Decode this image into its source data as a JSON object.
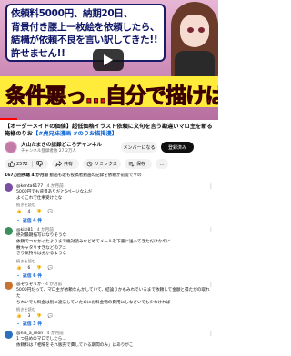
{
  "video": {
    "speech_text": "依頼料5000円、納期20日、\n背景付き腰上一枚絵を依頼したら、\n結構が依頼不良を言い訳してきた!!\n許せません!!",
    "banner_text": "条件悪っ…自分で描けば？",
    "progress": 0.08
  },
  "title": {
    "main": "【オーダーメイドの価値】超低価格イラスト依頼に文句を言う勘違いマロ主を斬る俺様のりお",
    "tags": "【#虎兄妹漫画 #のりお描掲漫】"
  },
  "channel": {
    "name": "大山たまきの記録どころチャンネル",
    "subs": "チャンネル登録者数 27.2万人",
    "member_label": "メンバーになる",
    "subscribe_label": "登録済み"
  },
  "actions": {
    "likes": "2572",
    "share": "共有",
    "remix": "リミックス",
    "save": "保存",
    "more": "…"
  },
  "description": {
    "views": "167万回視聴",
    "date": "4 か月前",
    "text": "動画も歌も投稿者動画の記録を依頼が前提ですの"
  },
  "comments": [
    {
      "user": "@kenta6177",
      "time": "4 か月前",
      "body": "5000円でも背景ありだと6ページなんだ\nよくこれで仕事受けたな",
      "more": "続きを読む",
      "likes": "4",
      "replies_label": "返信 4 件",
      "avatar_color": "#7a4ea3"
    },
    {
      "user": "@kikl81",
      "time": "4 か月前",
      "body": "絶対最期描写になりそうな\n依頼でつなかったよりまで絶対読みなどめてメールを下書に送ってきただけなのに\n敷キャタリすぎなどのアニ\nきり気持ちは分かるような",
      "more": "続きを読む",
      "likes": "6",
      "replies_label": "返信 6 件",
      "avatar_color": "#3a8f5c"
    },
    {
      "user": "@ぞうぞうか",
      "time": "4 か月前",
      "body": "5000円だって、マロ主が依頼なんかしていて、結論りかもみれでいるまで依頼して金額と得たがの取れた\nちれいでも料金は別に違法していたのにお料金物の費用にしなさいても少なければ",
      "more": "続きを読む",
      "likes": "3",
      "replies_label": "返信 3 件",
      "avatar_color": "#c9732e"
    },
    {
      "user": "@nia_a_mon",
      "time": "4 か月前",
      "body": "1 つ低めのマロでしたら…\n依頼料は「相場をそれ販売で費している期間のみ」はありがこ",
      "more": "",
      "likes": "",
      "replies_label": "",
      "avatar_color": "#2f6fbf"
    }
  ]
}
